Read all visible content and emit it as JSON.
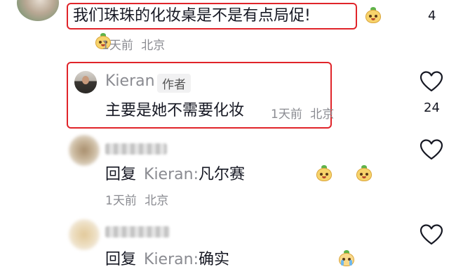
{
  "comments": [
    {
      "id": "top",
      "text": "我们珠珠的化妆桌是不是有点局促!",
      "time": "1天前",
      "location": "北京",
      "likes": "4"
    },
    {
      "id": "author-reply",
      "name": "Kieran",
      "badge": "作者",
      "text": "主要是她不需要化妆",
      "time": "1天前",
      "location": "北京",
      "likes": "24"
    },
    {
      "id": "reply-1",
      "reply_prefix": "回复",
      "reply_to": "Kieran",
      "colon": ":",
      "text": "凡尔赛",
      "time": "1天前",
      "location": "北京"
    },
    {
      "id": "reply-2",
      "reply_prefix": "回复",
      "reply_to": "Kieran",
      "colon": ":",
      "text": "确实"
    }
  ],
  "icons": {
    "like": "heart-outline-icon",
    "sticker": "cute-face-sticker-icon",
    "sticker_cry": "crying-face-sticker-icon"
  },
  "colors": {
    "highlight": "#e0242a",
    "meta_text": "#8a8b91",
    "main_text": "#161823"
  }
}
